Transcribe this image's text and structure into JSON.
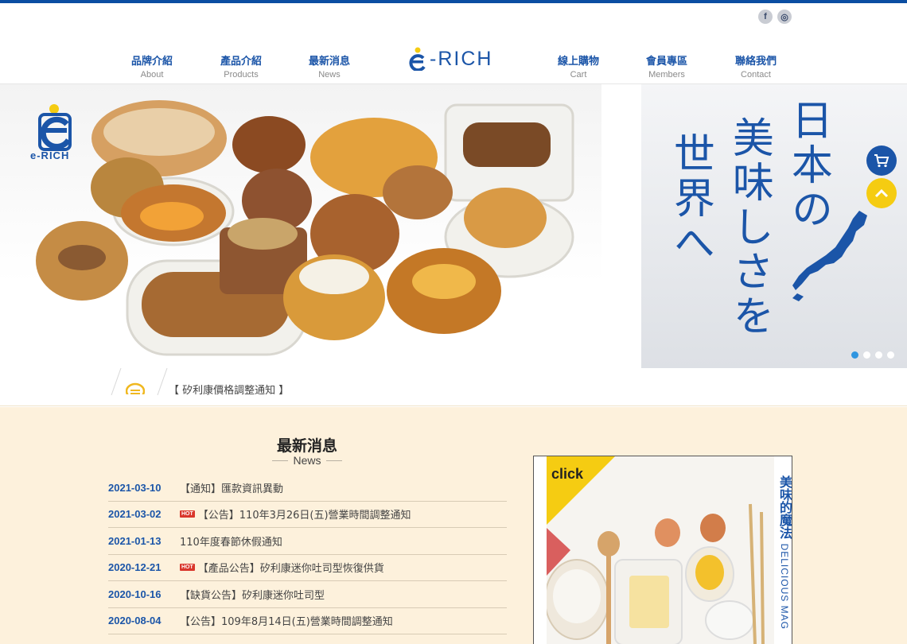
{
  "brand": {
    "logo_text": "-RICH",
    "side_logo_text": "e-RICH"
  },
  "social": [
    {
      "icon": "facebook-icon",
      "glyph": "f"
    },
    {
      "icon": "instagram-icon",
      "glyph": "◎"
    }
  ],
  "nav": [
    {
      "zh": "品牌介紹",
      "en": "About"
    },
    {
      "zh": "產品介紹",
      "en": "Products"
    },
    {
      "zh": "最新消息",
      "en": "News"
    },
    {
      "zh": "線上購物",
      "en": "Cart"
    },
    {
      "zh": "會員專區",
      "en": "Members"
    },
    {
      "zh": "聯絡我們",
      "en": "Contact"
    }
  ],
  "hero": {
    "side_text_col1": "日本の",
    "side_text_col2": "美味しさを",
    "side_text_col3": "世界へ",
    "slides": 4,
    "active_slide": 1
  },
  "ticker": {
    "text": "【 矽利康價格調整通知 】"
  },
  "news": {
    "title": "最新消息",
    "subtitle": "News",
    "items": [
      {
        "date": "2021-03-10",
        "hot": false,
        "text": "【通知】匯款資訊異動"
      },
      {
        "date": "2021-03-02",
        "hot": true,
        "text": "【公告】110年3月26日(五)營業時間調整通知"
      },
      {
        "date": "2021-01-13",
        "hot": false,
        "text": "110年度春節休假通知"
      },
      {
        "date": "2020-12-21",
        "hot": true,
        "text": "【產品公告】矽利康迷你吐司型恢復供貨"
      },
      {
        "date": "2020-10-16",
        "hot": false,
        "text": "【缺貨公告】矽利康迷你吐司型"
      },
      {
        "date": "2020-08-04",
        "hot": false,
        "text": "【公告】109年8月14日(五)營業時間調整通知"
      }
    ],
    "hot_label": "HOT"
  },
  "promo": {
    "click_label": "click",
    "title_zh": "美味的魔法",
    "title_en": "DELICIOUS MAG"
  },
  "colors": {
    "brand_blue": "#1b55a8",
    "accent_yellow": "#f5cc12",
    "news_bg": "#fdf1dc"
  }
}
